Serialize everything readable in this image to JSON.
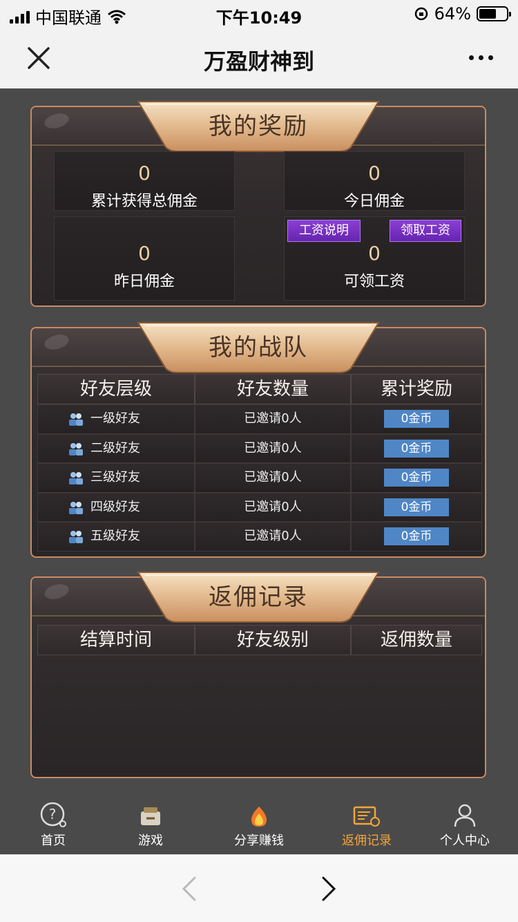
{
  "status_bar": {
    "carrier": "中国联通",
    "time": "下午10:49",
    "battery_percent": "64%",
    "battery_level": 0.64
  },
  "nav": {
    "title": "万盈财神到",
    "close_icon": "close-icon",
    "more_icon": "more-icon"
  },
  "rewards": {
    "title": "我的奖励",
    "total_commission": {
      "value": "0",
      "label": "累计获得总佣金"
    },
    "today_commission": {
      "value": "0",
      "label": "今日佣金"
    },
    "yesterday_commission": {
      "value": "0",
      "label": "昨日佣金"
    },
    "claimable_salary": {
      "value": "0",
      "label": "可领工资"
    },
    "salary_info_button": "工资说明",
    "claim_salary_button": "领取工资"
  },
  "team": {
    "title": "我的战队",
    "columns": [
      "好友层级",
      "好友数量",
      "累计奖励"
    ],
    "rows": [
      {
        "level": "一级好友",
        "count": "已邀请0人",
        "reward": "0金币"
      },
      {
        "level": "二级好友",
        "count": "已邀请0人",
        "reward": "0金币"
      },
      {
        "level": "三级好友",
        "count": "已邀请0人",
        "reward": "0金币"
      },
      {
        "level": "四级好友",
        "count": "已邀请0人",
        "reward": "0金币"
      },
      {
        "level": "五级好友",
        "count": "已邀请0人",
        "reward": "0金币"
      }
    ]
  },
  "rebate": {
    "title": "返佣记录",
    "columns": [
      "结算时间",
      "好友级别",
      "返佣数量"
    ]
  },
  "tabs": [
    {
      "label": "首页",
      "icon": "help-icon",
      "active": false
    },
    {
      "label": "游戏",
      "icon": "games-icon",
      "active": false
    },
    {
      "label": "分享赚钱",
      "icon": "share-fire-icon",
      "active": false
    },
    {
      "label": "返佣记录",
      "icon": "rebate-record-icon",
      "active": true
    },
    {
      "label": "个人中心",
      "icon": "user-icon",
      "active": false
    }
  ],
  "colors": {
    "accent": "#f3a53b",
    "panel_border": "#c98b62",
    "gold_text": "#e8cfa0",
    "purple_button": "#7b35c4",
    "coin_badge": "#4f86c6"
  }
}
